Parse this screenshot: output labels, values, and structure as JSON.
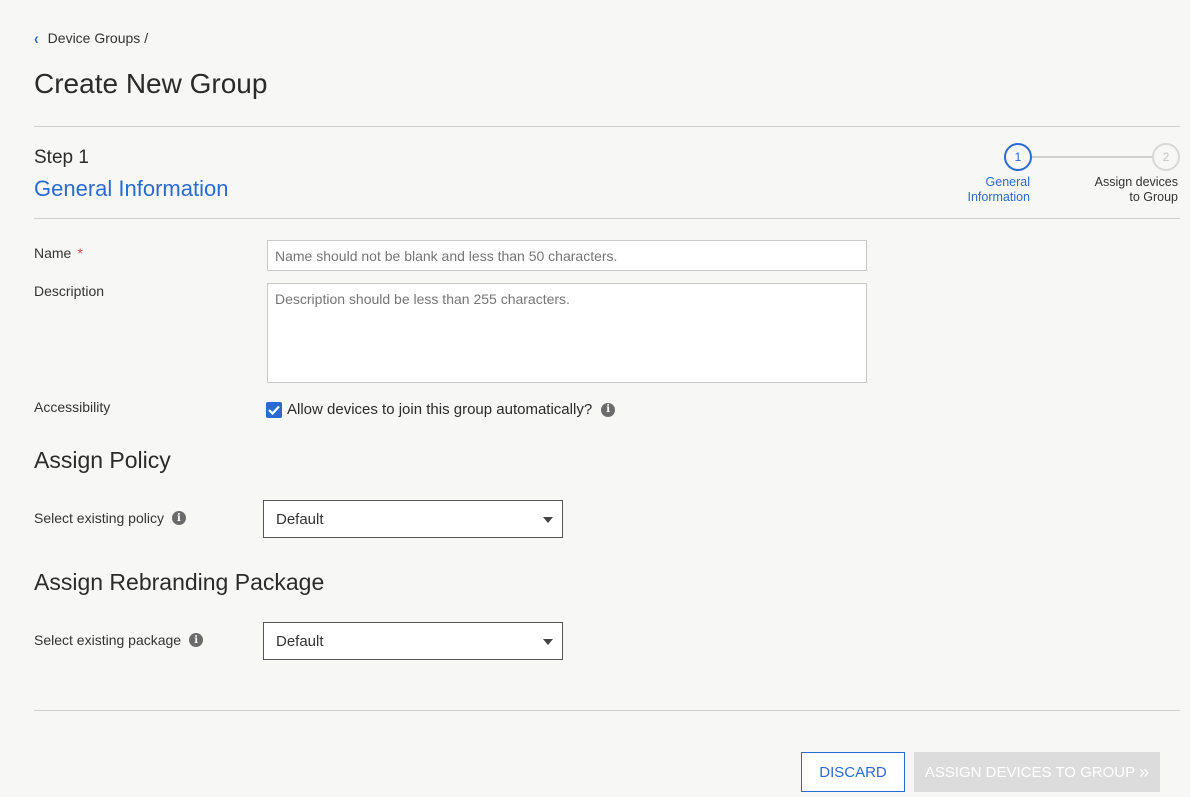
{
  "breadcrumb": {
    "parent": "Device Groups",
    "separator": "/"
  },
  "page": {
    "title": "Create New Group"
  },
  "step": {
    "number_label": "Step 1",
    "title": "General Information",
    "stepper": [
      {
        "number": "1",
        "label": "General Information",
        "state": "active"
      },
      {
        "number": "2",
        "label": "Assign devices to Group",
        "state": "inactive"
      }
    ]
  },
  "form": {
    "name_label": "Name",
    "name_required": "*",
    "name_placeholder": "Name should not be blank and less than 50 characters.",
    "name_value": "",
    "description_label": "Description",
    "description_placeholder": "Description should be less than 255 characters.",
    "description_value": "",
    "accessibility_label": "Accessibility",
    "accessibility_checkbox_label": "Allow devices to join this group automatically?",
    "accessibility_checked": true
  },
  "policy": {
    "section_title": "Assign Policy",
    "select_label": "Select existing policy",
    "selected": "Default"
  },
  "rebranding": {
    "section_title": "Assign Rebranding Package",
    "select_label": "Select existing package",
    "selected": "Default"
  },
  "actions": {
    "discard_label": "DISCARD",
    "assign_label": "ASSIGN DEVICES TO GROUP",
    "assign_icon": "»"
  },
  "colors": {
    "accent": "#2a6ad3",
    "required": "#e0443e",
    "disabled_button": "#dcdcdc",
    "background": "#f7f7f5"
  }
}
